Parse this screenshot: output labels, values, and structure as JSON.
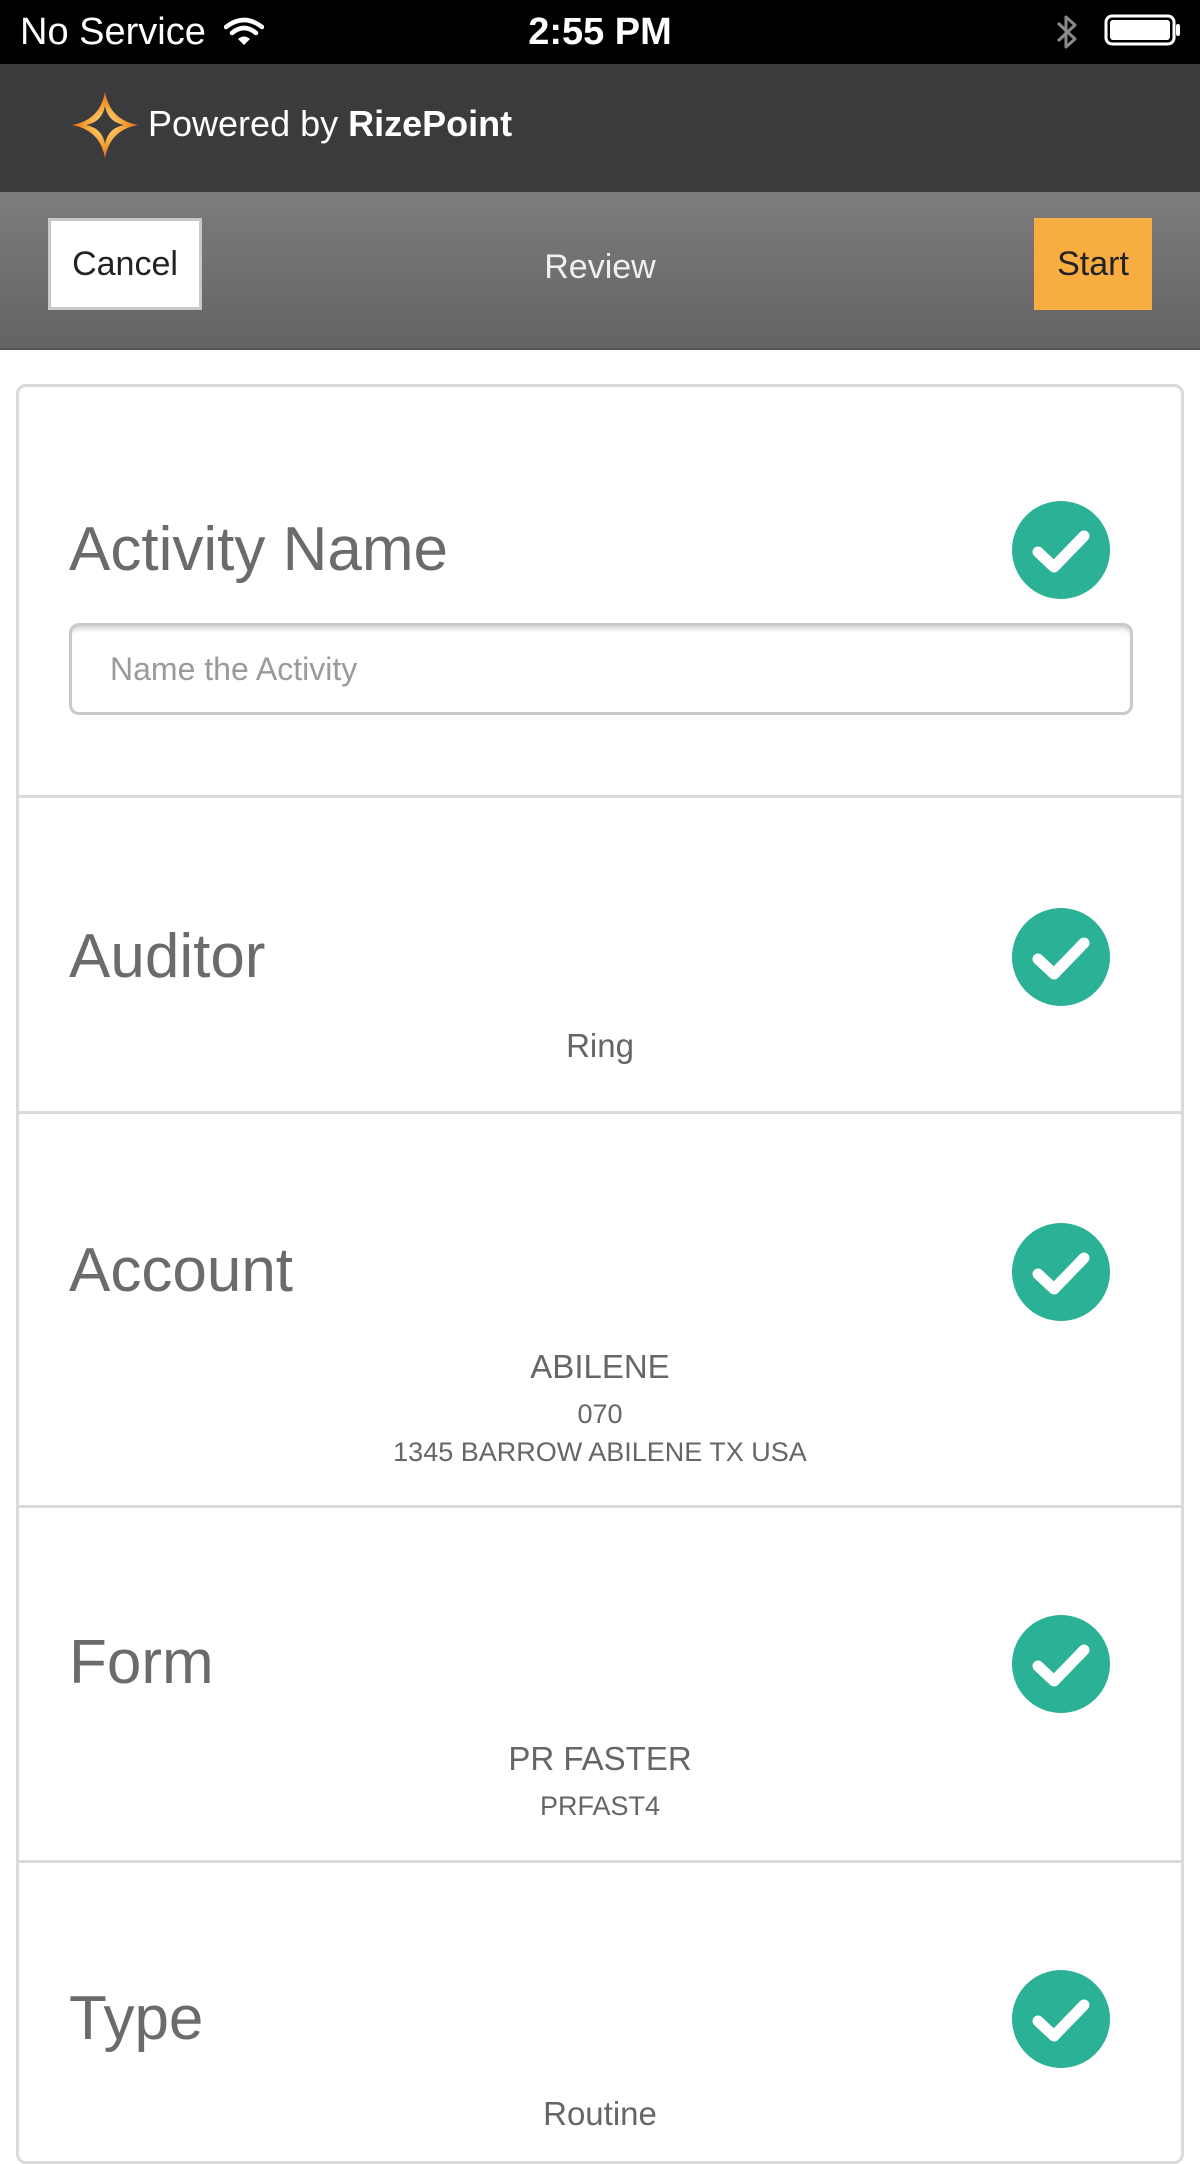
{
  "status_bar": {
    "carrier": "No Service",
    "time": "2:55 PM"
  },
  "brand": {
    "powered_by": "Powered by ",
    "name": "RizePoint",
    "logo_colors": [
      "#f39a2b",
      "#e8452c"
    ]
  },
  "nav": {
    "cancel_label": "Cancel",
    "title": "Review",
    "start_label": "Start",
    "start_color": "#f7ad40"
  },
  "colors": {
    "check": "#2bb195",
    "title_text": "#6b6b6b"
  },
  "sections": {
    "activity": {
      "title": "Activity Name",
      "input_value": "",
      "input_placeholder": "Name the Activity",
      "status_icon": "check-circle-icon"
    },
    "auditor": {
      "title": "Auditor",
      "value": "Ring",
      "status_icon": "check-circle-icon"
    },
    "account": {
      "title": "Account",
      "name": "ABILENE",
      "number": "070",
      "address": "1345 BARROW ABILENE TX USA",
      "status_icon": "check-circle-icon"
    },
    "form": {
      "title": "Form",
      "name": "PR FASTER",
      "code": "PRFAST4",
      "status_icon": "check-circle-icon"
    },
    "type": {
      "title": "Type",
      "value": "Routine",
      "status_icon": "check-circle-icon"
    }
  }
}
